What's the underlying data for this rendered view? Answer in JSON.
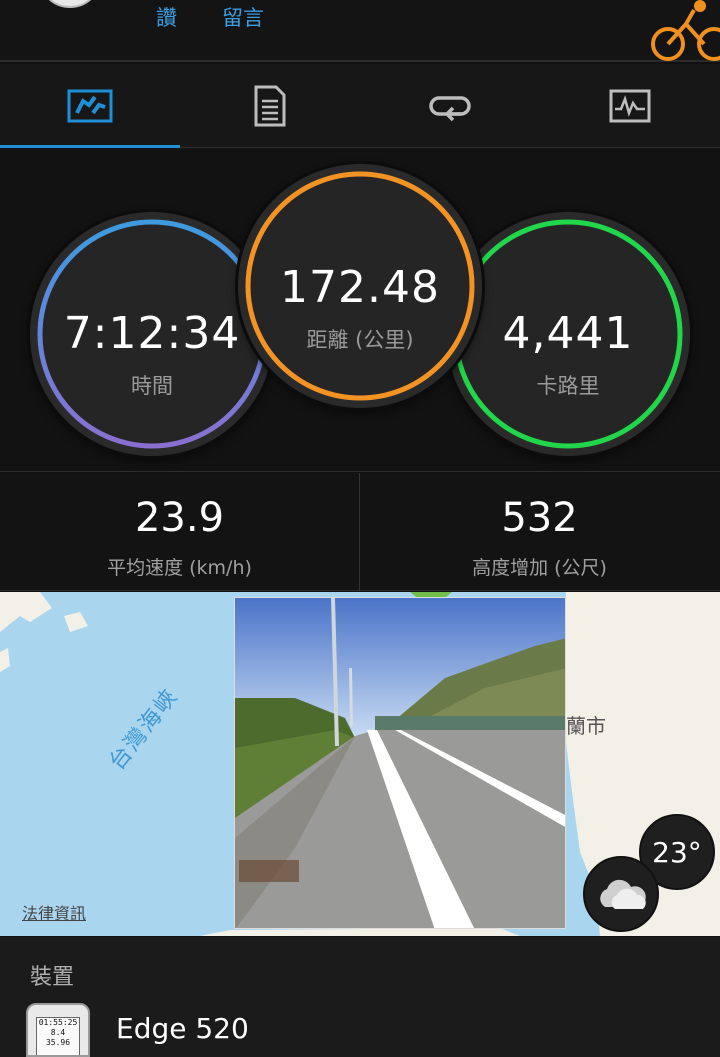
{
  "header": {
    "like_label": "讚",
    "comment_label": "留言",
    "activity_icon": "cycling-icon",
    "accent": "#f0901e"
  },
  "tabs": [
    {
      "icon": "overview-icon",
      "active": true
    },
    {
      "icon": "details-icon",
      "active": false
    },
    {
      "icon": "laps-icon",
      "active": false
    },
    {
      "icon": "chart-icon",
      "active": false
    }
  ],
  "rings": {
    "time": {
      "value": "7:12:34",
      "label": "時間",
      "color": "#4a8fe0"
    },
    "distance": {
      "value": "172.48",
      "label": "距離 (公里)",
      "color": "#f39324"
    },
    "calories": {
      "value": "4,441",
      "label": "卡路里",
      "color": "#21d64a"
    }
  },
  "stats": {
    "avg_speed": {
      "value": "23.9",
      "label": "平均速度 (km/h)"
    },
    "elevation_gain": {
      "value": "532",
      "label": "高度增加 (公尺)"
    }
  },
  "map": {
    "strait_label": "台灣海峽",
    "city_label": "蘭市",
    "legal_link": "法律資訊",
    "temperature": "23°",
    "weather_icon": "cloudy-icon"
  },
  "devices": {
    "title": "裝置",
    "device_name": "Edge 520",
    "screen_lines": [
      "01:55:25",
      "8.4",
      "35.96"
    ]
  }
}
